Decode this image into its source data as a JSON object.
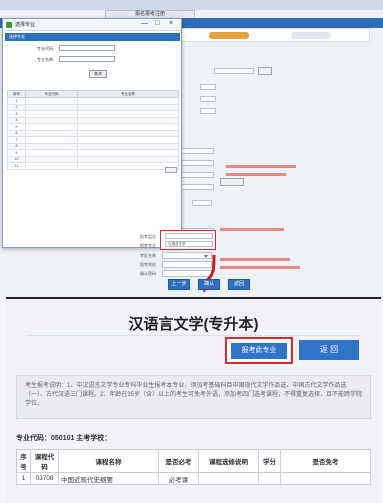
{
  "top": {
    "window_title": "报名报考注册",
    "dialog": {
      "title": "选择专业",
      "tab_label": "选择专业",
      "fields": [
        {
          "label": "专业代码:"
        },
        {
          "label": "专业名称:"
        }
      ],
      "query_button": "查询",
      "columns": [
        "序号",
        "专业代码",
        "专业名称"
      ],
      "rows": [
        [
          "1",
          "",
          ""
        ],
        [
          "2",
          "",
          ""
        ],
        [
          "3",
          "",
          ""
        ],
        [
          "4",
          "",
          ""
        ],
        [
          "5",
          "",
          ""
        ],
        [
          "6",
          "",
          ""
        ],
        [
          "7",
          "",
          ""
        ],
        [
          "8",
          "",
          ""
        ],
        [
          "9",
          "",
          ""
        ],
        [
          "10",
          "",
          ""
        ],
        [
          "11",
          "",
          ""
        ]
      ],
      "pager_text": "·",
      "controls": {
        "minimize": "—",
        "maximize": "□",
        "close": "×"
      }
    },
    "form": {
      "labels": [
        {
          "text": "报考层次"
        },
        {
          "text": "报考专业"
        },
        {
          "text": "考区名称"
        },
        {
          "text": "报考院校"
        },
        {
          "text": "确认密码"
        }
      ],
      "highlight_values": [
        "",
        "汉语言文学"
      ],
      "prev_button": "上一步",
      "next_button": "确认",
      "extra_button": "返回"
    }
  },
  "bottom": {
    "title": "汉语言文学(专升本)",
    "apply_button": "报考此专业",
    "back_button": "返 回",
    "notice": "考生报考说明：1、中汉语言文学专业专科毕业生报考本专业，须加考基础科目中国现代文学作品选、中国古代文学作品选（一）、古代汉语三门课程。2、年龄在35岁（含）以上的考生可免考外语，须加考四门选考课程，不得重复选择，且不能跨学院学位。",
    "major_code_label": "专业代码：050101 主考学校：",
    "table": {
      "columns": [
        "序号",
        "课程代码",
        "课程名称",
        "是否必考",
        "课程选修说明",
        "学分",
        "是否免考"
      ],
      "rows": [
        [
          "1",
          "03708",
          "中国近现代史纲要",
          "必考课",
          "",
          "",
          ""
        ]
      ]
    }
  }
}
